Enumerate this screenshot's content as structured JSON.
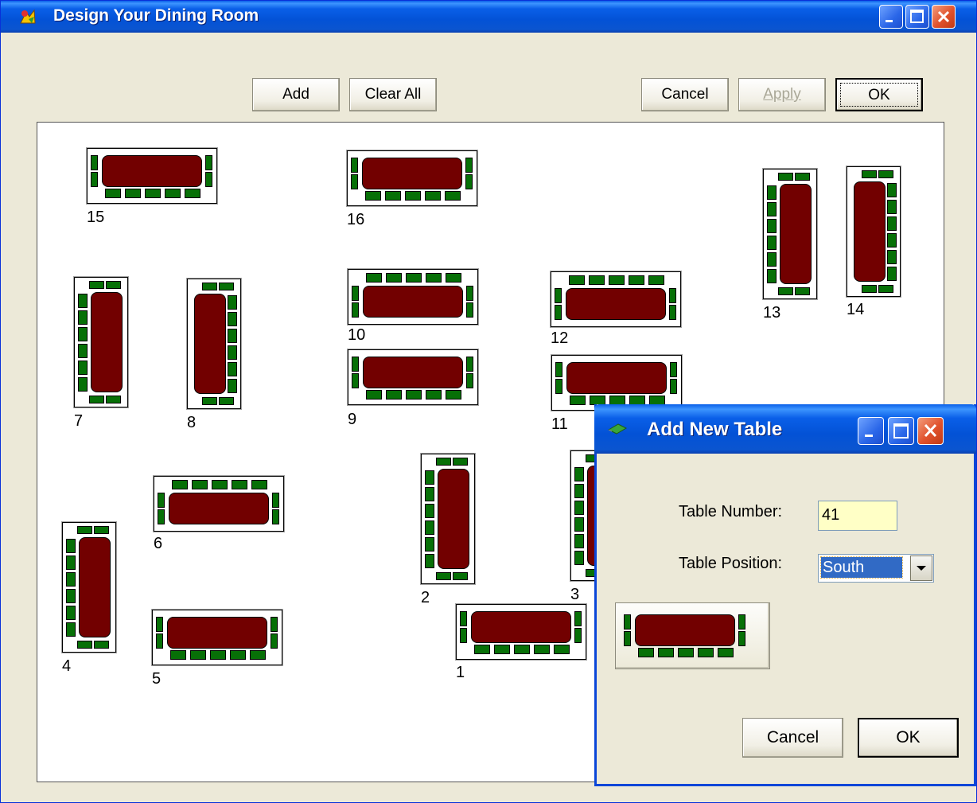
{
  "window": {
    "title": "Design Your Dining Room"
  },
  "toolbar": {
    "add_label": "Add",
    "clear_all_label": "Clear All",
    "cancel_label": "Cancel",
    "apply_label": "Apply",
    "ok_label": "OK"
  },
  "floor_plan": {
    "tables": [
      {
        "number": "15",
        "orientation": "horizontal-north"
      },
      {
        "number": "16",
        "orientation": "horizontal-north"
      },
      {
        "number": "13",
        "orientation": "vertical-west"
      },
      {
        "number": "14",
        "orientation": "vertical-east"
      },
      {
        "number": "7",
        "orientation": "vertical-west"
      },
      {
        "number": "8",
        "orientation": "vertical-east"
      },
      {
        "number": "10",
        "orientation": "horizontal-south"
      },
      {
        "number": "12",
        "orientation": "horizontal-south"
      },
      {
        "number": "9",
        "orientation": "horizontal-north"
      },
      {
        "number": "11",
        "orientation": "horizontal-north"
      },
      {
        "number": "6",
        "orientation": "horizontal-south"
      },
      {
        "number": "2",
        "orientation": "vertical-west"
      },
      {
        "number": "3",
        "orientation": "vertical-west"
      },
      {
        "number": "4",
        "orientation": "vertical-west"
      },
      {
        "number": "5",
        "orientation": "horizontal-north"
      },
      {
        "number": "1",
        "orientation": "horizontal-north"
      }
    ]
  },
  "dialog": {
    "title": "Add New Table",
    "table_number_label": "Table Number:",
    "table_number_value": "41",
    "table_position_label": "Table Position:",
    "table_position_value": "South",
    "cancel_label": "Cancel",
    "ok_label": "OK"
  },
  "colors": {
    "table_top": "#720000",
    "chair": "#077007",
    "titlebar": "#0a5fe8"
  }
}
